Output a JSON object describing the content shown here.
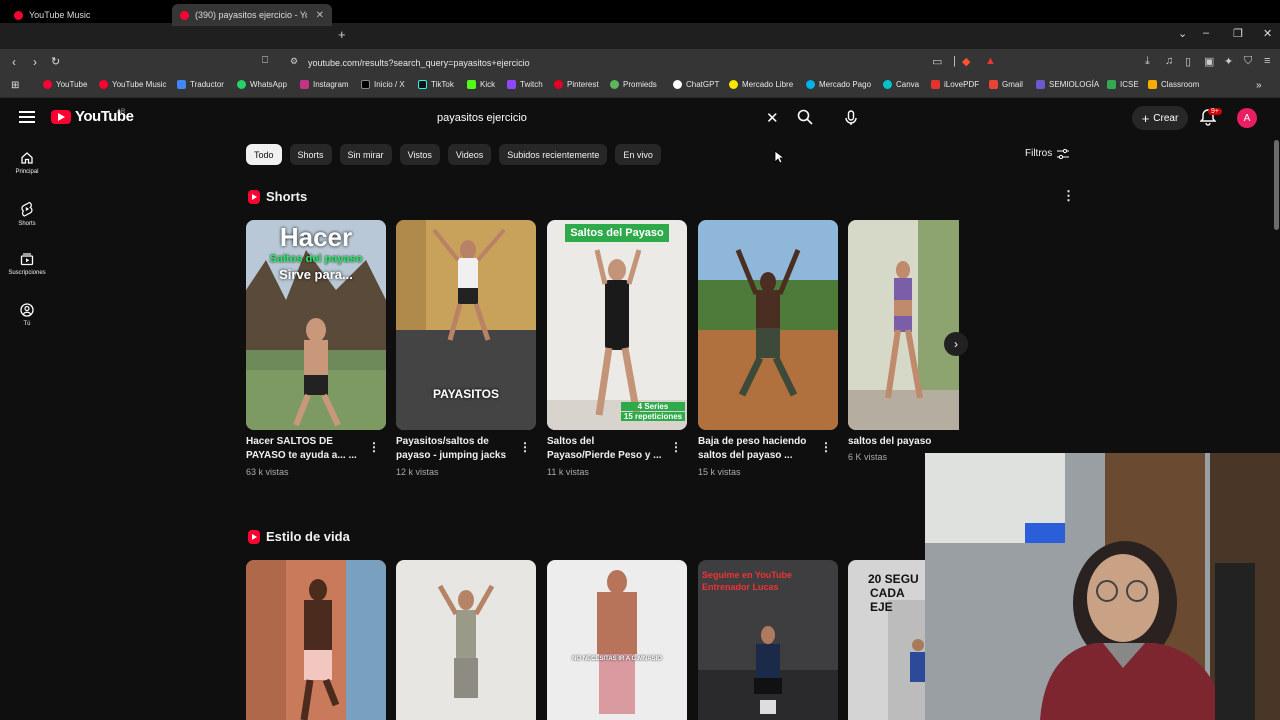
{
  "browser": {
    "tabs": [
      {
        "label": "YouTube Music"
      },
      {
        "label": "(390) payasitos ejercicio - YouTu"
      }
    ],
    "url": "youtube.com/results?search_query=payasitos+ejercicio",
    "bookmarks": [
      "YouTube",
      "YouTube Music",
      "Traductor",
      "WhatsApp",
      "Instagram",
      "Inicio / X",
      "TikTok",
      "Kick",
      "Twitch",
      "Pinterest",
      "Promieds",
      "ChatGPT",
      "Mercado Libre",
      "Mercado Pago",
      "Canva",
      "iLovePDF",
      "Gmail",
      "SEMIOLOGÍA",
      "ICSE",
      "Classroom"
    ]
  },
  "header": {
    "logo_text": "YouTube",
    "country": "AR",
    "search_value": "payasitos ejercicio",
    "create_label": "Crear",
    "notif_badge": "9+",
    "avatar_letter": "A"
  },
  "sidebar": {
    "items": [
      {
        "label": "Principal",
        "icon": "home-icon"
      },
      {
        "label": "Shorts",
        "icon": "shorts-icon"
      },
      {
        "label": "Suscripciones",
        "icon": "subscriptions-icon"
      },
      {
        "label": "Tú",
        "icon": "you-icon"
      }
    ]
  },
  "chips": [
    "Todo",
    "Shorts",
    "Sin mirar",
    "Vistos",
    "Videos",
    "Subidos recientemente",
    "En vivo"
  ],
  "filters_label": "Filtros",
  "shorts_section": {
    "title": "Shorts",
    "items": [
      {
        "title": "Hacer SALTOS DE PAYASO te ayuda a... ...",
        "views": "63 k vistas",
        "overlay1": "Hacer",
        "overlay2": "Saltos del payaso",
        "overlay3": "Sirve para..."
      },
      {
        "title": "Payasitos/saltos de payaso - jumping jacks",
        "views": "12 k vistas",
        "overlay1": "PAYASITOS"
      },
      {
        "title": "Saltos del Payaso/Pierde Peso y ...",
        "views": "11 k vistas",
        "overlay1": "Saltos del Payaso",
        "overlay2": "4 Series",
        "overlay3": "15 repeticiones"
      },
      {
        "title": "Baja de peso haciendo saltos del payaso ...",
        "views": "15 k vistas"
      },
      {
        "title": "saltos del payaso",
        "views": "6 K vistas"
      }
    ]
  },
  "lifestyle_section": {
    "title": "Estilo de vida",
    "overlays": [
      "Seguime en YouTube",
      "Entrenador Lucas",
      "20 SEGU",
      "CADA EJE",
      "NO NECESITAS IR A GIMNASIO"
    ]
  },
  "colors": {
    "accent": "#ff0033",
    "bg": "#0f0f0f",
    "chip": "#272727"
  }
}
